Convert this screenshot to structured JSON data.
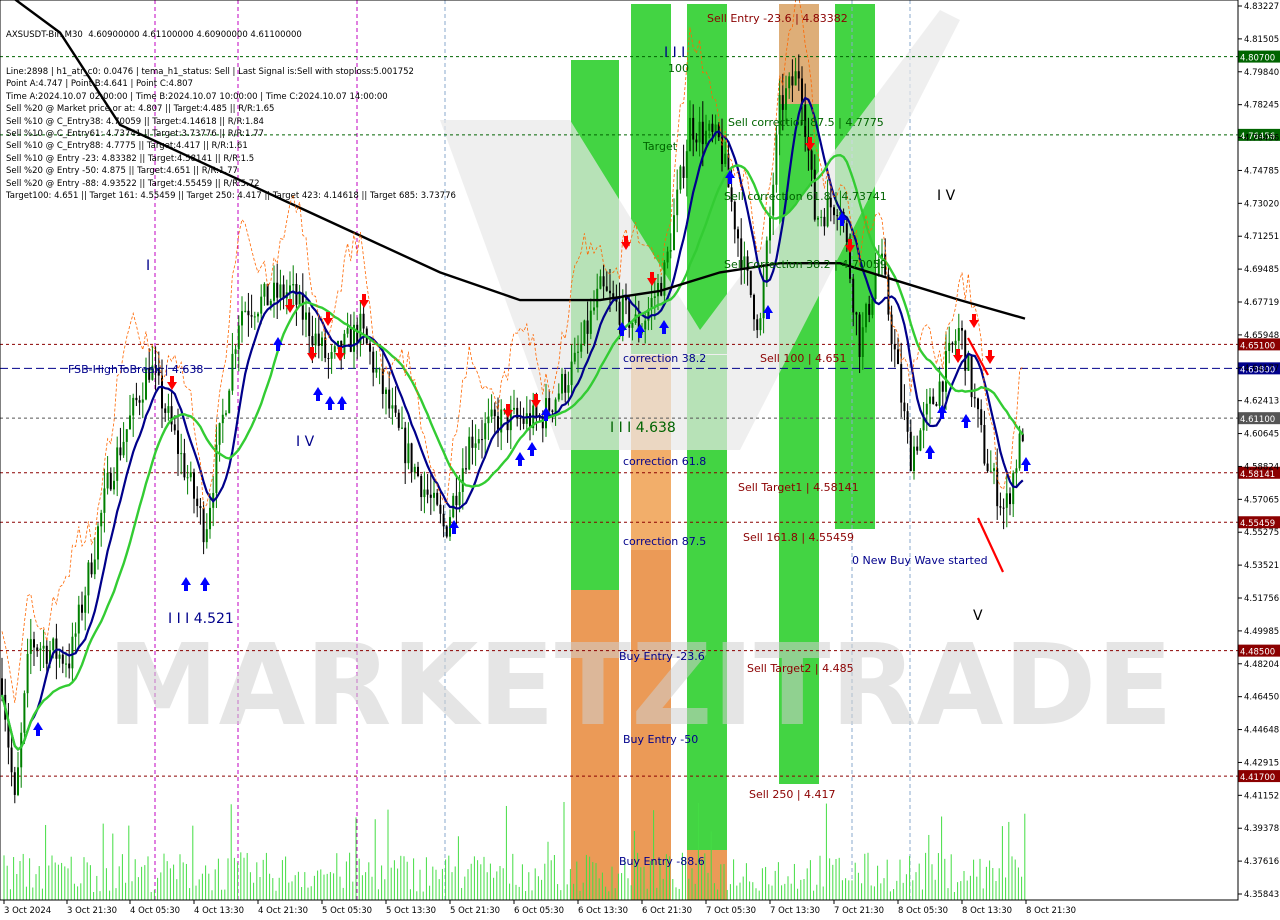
{
  "symbol_line": "AXSUSDT-Bin,M30  4.60900000 4.61100000 4.60900000 4.61100000",
  "info_lines": [
    "Line:2898 | h1_atr_c0: 0.0476 | tema_h1_status: Sell | Last Signal is:Sell with stoploss:5.001752",
    "Point A:4.747 | Point B:4.641 | Point C:4.807",
    "Time A:2024.10.07 02:00:00 | Time B:2024.10.07 10:00:00 | Time C:2024.10.07 14:00:00",
    "Sell %20 @ Market price or at: 4.807 || Target:4.485 || R/R:1.65",
    "Sell %10 @ C_Entry38: 4.70059 || Target:4.14618 || R/R:1.84",
    "Sell %10 @ C_Entry61: 4.73741 || Target:3.73776 || R/R:1.77",
    "Sell %10 @ C_Entry88: 4.7775 || Target:4.417 || R/R:1.61",
    "Sell %10 @ Entry -23: 4.83382 || Target:4.58141 || R/R:1.5",
    "Sell %20 @ Entry -50: 4.875 || Target:4.651 || R/R:1.77",
    "Sell %20 @ Entry -88: 4.93522 || Target:4.55459 || R/R:5.72",
    "Target100: 4.651 || Target 161: 4.55459 || Target 250: 4.417 || Target 423: 4.14618 || Target 685: 3.73776"
  ],
  "watermark": "MARKETZITRADE",
  "colors": {
    "bull_candle": "#008000",
    "bear_candle": "#000000",
    "green_zone": "#22cc22",
    "orange_zone": "#e8883a",
    "ma_black": "#000000",
    "ma_blue": "#00008b",
    "ma_green": "#33cc33",
    "level_red": "#8b0000",
    "level_green": "#006400",
    "hline_blue": "#00008b",
    "sell_arrow": "#ff0000",
    "buy_arrow": "#0000ff"
  },
  "chart_data": {
    "type": "candlestick",
    "x_labels": [
      "3 Oct 2024",
      "3 Oct 21:30",
      "4 Oct 05:30",
      "4 Oct 13:30",
      "4 Oct 21:30",
      "5 Oct 05:30",
      "5 Oct 13:30",
      "5 Oct 21:30",
      "6 Oct 05:30",
      "6 Oct 13:30",
      "6 Oct 21:30",
      "7 Oct 05:30",
      "7 Oct 13:30",
      "7 Oct 21:30",
      "8 Oct 05:30",
      "8 Oct 13:30",
      "8 Oct 21:30"
    ],
    "y_ticks": [
      "4.83227",
      "4.81505",
      "4.79840",
      "4.78245",
      "4.76456",
      "4.74785",
      "4.73020",
      "4.71251",
      "4.69485",
      "4.67719",
      "4.65948",
      "4.64177",
      "4.62413",
      "4.60645",
      "4.58824",
      "4.57065",
      "4.55275",
      "4.53521",
      "4.51756",
      "4.49985",
      "4.48204",
      "4.46450",
      "4.44648",
      "4.42915",
      "4.41152",
      "4.39378",
      "4.37616",
      "4.35843"
    ],
    "ylim": [
      4.352,
      4.8355
    ],
    "price_levels": [
      {
        "label": "4.80700",
        "value": 4.807,
        "color": "#006400"
      },
      {
        "label": "4.76456",
        "value": 4.76456,
        "color": "#006400"
      },
      {
        "label": "4.65100",
        "value": 4.651,
        "color": "#8b0000"
      },
      {
        "label": "4.63800",
        "value": 4.638,
        "color": "#00008b"
      },
      {
        "label": "4.61100",
        "value": 4.611,
        "color": "#555555"
      },
      {
        "label": "4.58141",
        "value": 4.58141,
        "color": "#8b0000"
      },
      {
        "label": "4.55459",
        "value": 4.55459,
        "color": "#8b0000"
      },
      {
        "label": "4.48500",
        "value": 4.485,
        "color": "#8b0000"
      },
      {
        "label": "4.41700",
        "value": 4.417,
        "color": "#8b0000"
      }
    ],
    "annotations": [
      {
        "text": "Sell Entry -23.6 | 4.83382",
        "color": "#8b0000"
      },
      {
        "text": "Sell correction 87.5 | 4.7775",
        "color": "#006400"
      },
      {
        "text": "Sell correction 61.8 | 4.73741",
        "color": "#006400"
      },
      {
        "text": "Sell correction 38.2 | 4.70059",
        "color": "#006400"
      },
      {
        "text": "Sell 100 | 4.651",
        "color": "#8b0000"
      },
      {
        "text": "FSB-HighToBreak | 4.638",
        "color": "#00008b"
      },
      {
        "text": "I I I 4.638",
        "color": "#006400"
      },
      {
        "text": "correction 38.2",
        "color": "#00008b"
      },
      {
        "text": "correction 61.8",
        "color": "#00008b"
      },
      {
        "text": "correction 87.5",
        "color": "#00008b"
      },
      {
        "text": "Sell Target1 | 4.58141",
        "color": "#8b0000"
      },
      {
        "text": "Sell 161.8 | 4.55459",
        "color": "#8b0000"
      },
      {
        "text": "0 New Buy Wave started",
        "color": "#00008b"
      },
      {
        "text": "Buy Entry -23.6",
        "color": "#00008b"
      },
      {
        "text": "Buy Entry -50",
        "color": "#00008b"
      },
      {
        "text": "Buy Entry -88.6",
        "color": "#00008b"
      },
      {
        "text": "Sell Target2 | 4.485",
        "color": "#8b0000"
      },
      {
        "text": "Sell 250 | 4.417",
        "color": "#8b0000"
      },
      {
        "text": "I I I 4.521",
        "color": "#00008b"
      },
      {
        "text": "Target",
        "color": "#006400"
      },
      {
        "text": "100",
        "color": "#006400"
      },
      {
        "text": "I I I",
        "color": "#00008b"
      },
      {
        "text": "I V",
        "color": "#00008b"
      },
      {
        "text": "I",
        "color": "#00008b"
      },
      {
        "text": "V",
        "color": "#000000"
      },
      {
        "text": "I V",
        "color": "#000000"
      }
    ]
  }
}
